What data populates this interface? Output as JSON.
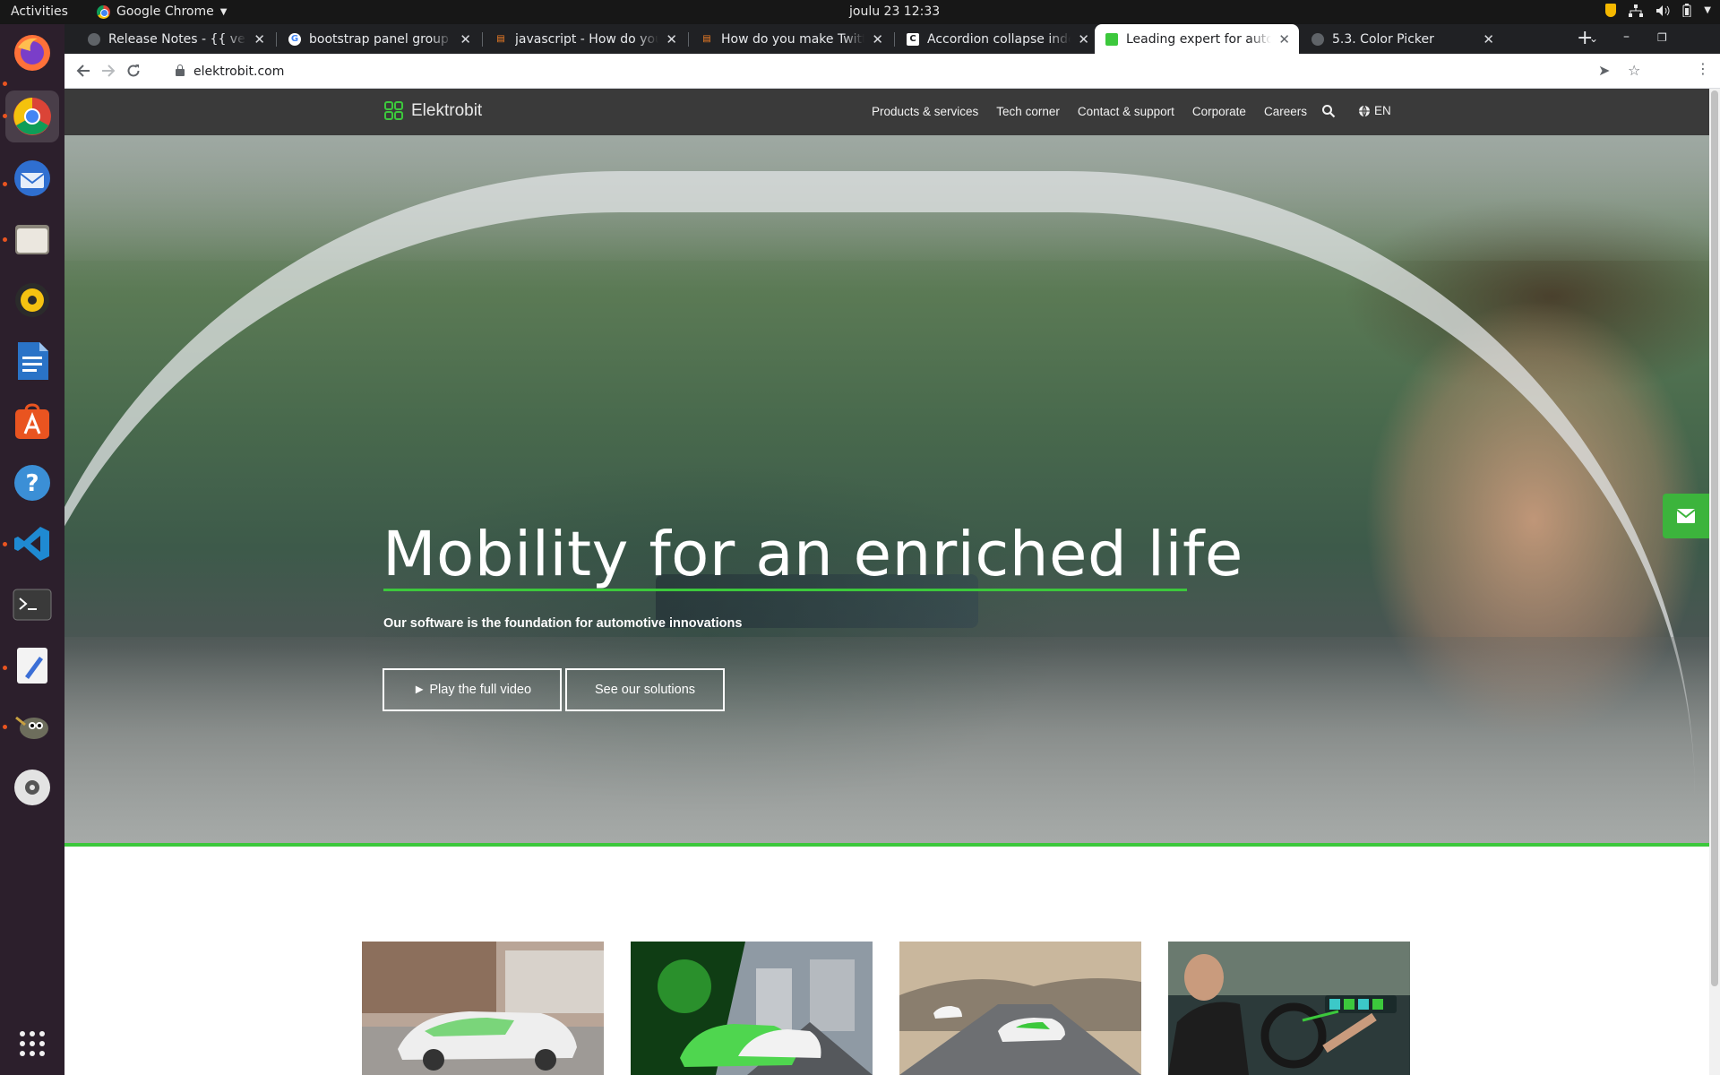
{
  "os": {
    "activities": "Activities",
    "app_menu": "Google Chrome",
    "clock": "joulu 23  12:33"
  },
  "dock": {
    "items": [
      {
        "name": "firefox",
        "color": "#ff7139"
      },
      {
        "name": "chrome",
        "color": "#4285f4"
      },
      {
        "name": "thunderbird",
        "color": "#2f6fd0"
      },
      {
        "name": "files",
        "color": "#d9d4c8"
      },
      {
        "name": "rhythmbox",
        "color": "#f5c211"
      },
      {
        "name": "writer",
        "color": "#2a73c7"
      },
      {
        "name": "software",
        "color": "#e95420"
      },
      {
        "name": "help",
        "color": "#3b8fd6"
      },
      {
        "name": "vscode",
        "color": "#1f8ad2"
      },
      {
        "name": "terminal",
        "color": "#3a3a3a"
      },
      {
        "name": "text-editor",
        "color": "#f0f0f0"
      },
      {
        "name": "gimp",
        "color": "#6d6d5c"
      },
      {
        "name": "disc",
        "color": "#e0e0e0"
      }
    ]
  },
  "browser": {
    "tabs": [
      {
        "label": "Release Notes - {{ version }}"
      },
      {
        "label": "bootstrap panel group hover"
      },
      {
        "label": "javascript - How do you make"
      },
      {
        "label": "How do you make Twitter"
      },
      {
        "label": "Accordion collapse indent"
      },
      {
        "label": "Leading expert for automotive"
      },
      {
        "label": "5.3. Color Picker"
      }
    ],
    "active_tab": 5,
    "url": "elektrobit.com"
  },
  "site": {
    "brand": "Elektrobit",
    "brand_color": "#3cc83c",
    "nav": [
      "Products & services",
      "Tech corner",
      "Contact & support",
      "Corporate",
      "Careers"
    ],
    "language": "EN",
    "hero": {
      "title": "Mobility for an enriched life",
      "subtitle": "Our software is the foundation for automotive innovations",
      "play_button": "► Play the full video",
      "solutions_button": "See our solutions"
    },
    "contact_icon": "envelope-icon"
  }
}
